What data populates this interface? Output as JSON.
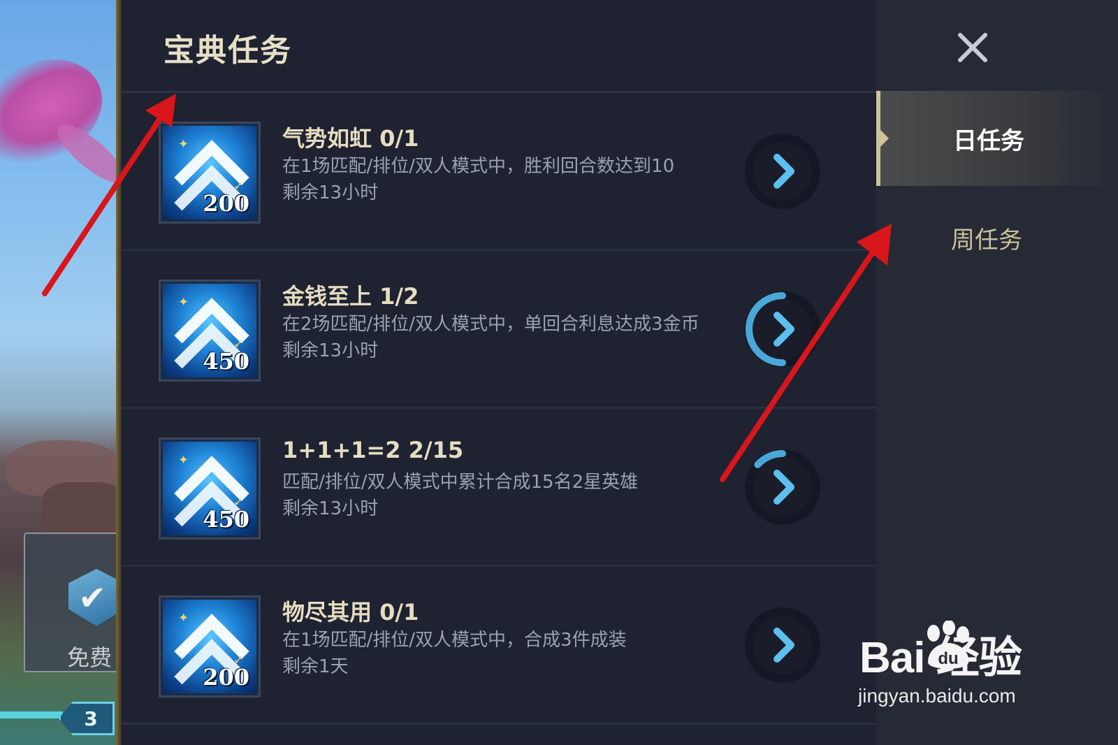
{
  "panel": {
    "title": "宝典任务"
  },
  "tasks": [
    {
      "name": "气势如虹 0/1",
      "desc": "在1场匹配/排位/双人模式中，胜利回合数达到10",
      "time": "剩余13小时",
      "reward": "200",
      "progress": 0
    },
    {
      "name": "金钱至上 1/2",
      "desc": "在2场匹配/排位/双人模式中，单回合利息达成3金币",
      "time": "剩余13小时",
      "reward": "450",
      "progress": 0.5
    },
    {
      "name": "1+1+1=2 2/15",
      "desc": "匹配/排位/双人模式中累计合成15名2星英雄",
      "time": "剩余13小时",
      "reward": "450",
      "progress": 0.1333
    },
    {
      "name": "物尽其用 0/1",
      "desc": "在1场匹配/排位/双人模式中，合成3件成装",
      "time": "剩余1天",
      "reward": "200",
      "progress": 0
    }
  ],
  "tabs": {
    "daily": "日任务",
    "weekly": "周任务"
  },
  "game": {
    "free_label": "免费",
    "level": "3"
  },
  "watermark": {
    "logo": "Bai  经验",
    "url": "jingyan.baidu.com"
  },
  "colors": {
    "panel_bg": "#1e2231",
    "tab_bg": "#262a35",
    "accent_gold": "#cfc39a",
    "progress_ring": "#4aa7d8",
    "annotation_arrow": "#d8161b"
  }
}
